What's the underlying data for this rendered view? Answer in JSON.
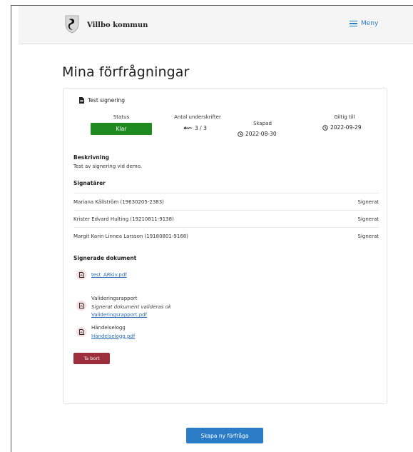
{
  "navbar": {
    "brand": "Villbo kommun",
    "menu_label": "Meny"
  },
  "page": {
    "title": "Mina förfrågningar"
  },
  "request": {
    "name": "Test signering",
    "status_label": "Status",
    "status_value": "Klar",
    "signatures_label": "Antal underskrifter",
    "signatures_value": "3 / 3",
    "created_label": "Skapad",
    "created_value": "2022-08-30",
    "valid_label": "Giltig till",
    "valid_value": "2022-09-29",
    "description_heading": "Beskrivning",
    "description": "Test av signering vid demo.",
    "signers_heading": "Signatärer",
    "signers": [
      {
        "name": "Mariana Källström (19630205-2383)",
        "status": "Signerat"
      },
      {
        "name": "Krister Edvard Hulting (19210811-9138)",
        "status": "Signerat"
      },
      {
        "name": "Margit Karin Linnea Larsson (19180801-9168)",
        "status": "Signerat"
      }
    ],
    "documents_heading": "Signerade dokument",
    "documents": {
      "archive_link": "test_ARkiv.pdf",
      "validation_title": "Valideringsrapport",
      "validation_note": "Signerat dokument valideras ok",
      "validation_link": "Valideringsrapport.pdf",
      "event_title": "Händelselogg",
      "event_link": "Händelselogg.pdf"
    },
    "delete_label": "Ta bort"
  },
  "actions": {
    "new_request_label": "Skapa ny förfråga"
  },
  "colors": {
    "accent": "#2a7cc7",
    "success": "#1f8a1f",
    "danger": "#9b2f3c",
    "link": "#2a6db5"
  },
  "icons": [
    "crest-logo-icon",
    "hamburger-icon",
    "document-icon",
    "signature-icon",
    "clock-icon",
    "pdf-file-icon"
  ]
}
